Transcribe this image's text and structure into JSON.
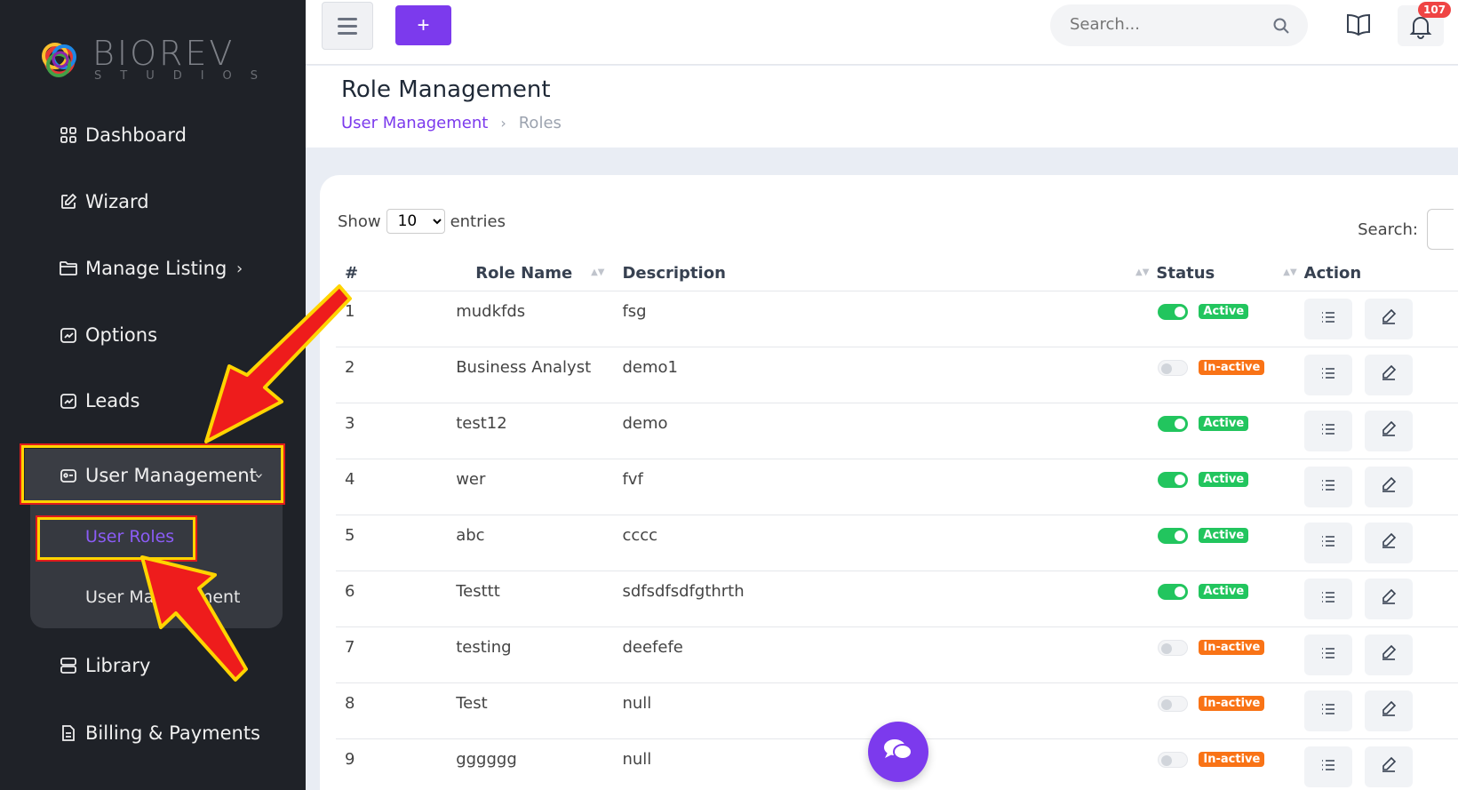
{
  "brand": {
    "name": "BIOREV",
    "tagline": "STUDIOS"
  },
  "sidebar": {
    "items": [
      {
        "label": "Dashboard",
        "icon": "grid-icon"
      },
      {
        "label": "Wizard",
        "icon": "edit-square-icon"
      },
      {
        "label": "Manage Listing",
        "icon": "folder-icon"
      },
      {
        "label": "Options",
        "icon": "chart-square-icon"
      },
      {
        "label": "Leads",
        "icon": "chart-square-icon"
      },
      {
        "label": "User Management",
        "icon": "id-card-icon"
      },
      {
        "label": "Library",
        "icon": "server-icon"
      },
      {
        "label": "Billing & Payments",
        "icon": "document-icon"
      }
    ],
    "submenu": [
      {
        "label": "User Roles",
        "active": true
      },
      {
        "label": "User Management",
        "active": false
      }
    ]
  },
  "topbar": {
    "add_label": "+",
    "search_placeholder": "Search...",
    "notifications": "107"
  },
  "page": {
    "title": "Role Management",
    "breadcrumb_parent": "User Management",
    "breadcrumb_current": "Roles",
    "show_label": "Show",
    "entries_value": "10",
    "entries_label": "entries",
    "search_label": "Search:"
  },
  "table": {
    "headers": [
      "#",
      "Role Name",
      "Description",
      "Status",
      "Action"
    ],
    "rows": [
      {
        "num": "1",
        "name": "mudkfds",
        "desc": "fsg",
        "status": "Active"
      },
      {
        "num": "2",
        "name": "Business Analyst",
        "desc": "demo1",
        "status": "In-active"
      },
      {
        "num": "3",
        "name": "test12",
        "desc": "demo",
        "status": "Active"
      },
      {
        "num": "4",
        "name": "wer",
        "desc": "fvf",
        "status": "Active"
      },
      {
        "num": "5",
        "name": "abc",
        "desc": "cccc",
        "status": "Active"
      },
      {
        "num": "6",
        "name": "Testtt",
        "desc": "sdfsdfsdfgthrth",
        "status": "Active"
      },
      {
        "num": "7",
        "name": "testing",
        "desc": "deefefe",
        "status": "In-active"
      },
      {
        "num": "8",
        "name": "Test",
        "desc": "null",
        "status": "In-active"
      },
      {
        "num": "9",
        "name": "gggggg",
        "desc": "null",
        "status": "In-active"
      }
    ]
  },
  "colors": {
    "accent": "#7c3aed",
    "active": "#22c55e",
    "inactive": "#f97316",
    "sidebar": "#1f2228",
    "highlight": "#ffd400",
    "arrow": "#e01b1b"
  }
}
